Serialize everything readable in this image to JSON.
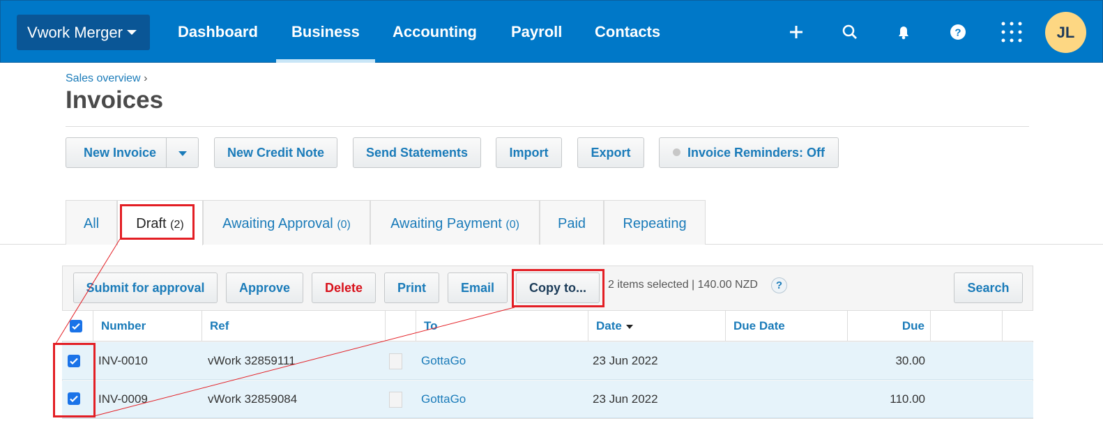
{
  "topnav": {
    "org": "Vwork Merger",
    "items": [
      "Dashboard",
      "Business",
      "Accounting",
      "Payroll",
      "Contacts"
    ],
    "active": "Business",
    "icons": [
      "plus-icon",
      "search-icon",
      "bell-icon",
      "help-icon",
      "apps-grid-icon"
    ],
    "avatar": "JL"
  },
  "page": {
    "breadcrumb": "Sales overview",
    "breadcrumb_sep": "›",
    "title": "Invoices"
  },
  "toolbar": {
    "new_invoice": "New Invoice",
    "new_credit_note": "New Credit Note",
    "send_statements": "Send Statements",
    "import": "Import",
    "export": "Export",
    "reminders": "Invoice Reminders: Off"
  },
  "tabs": [
    {
      "label": "All",
      "count": ""
    },
    {
      "label": "Draft",
      "count": "(2)"
    },
    {
      "label": "Awaiting Approval",
      "count": "(0)"
    },
    {
      "label": "Awaiting Payment",
      "count": "(0)"
    },
    {
      "label": "Paid",
      "count": ""
    },
    {
      "label": "Repeating",
      "count": ""
    }
  ],
  "actions": {
    "submit": "Submit for approval",
    "approve": "Approve",
    "delete": "Delete",
    "print": "Print",
    "email": "Email",
    "copy": "Copy to...",
    "selection": "2 items selected | 140.00 NZD",
    "help": "?",
    "search": "Search"
  },
  "table": {
    "columns": [
      "Number",
      "Ref",
      "To",
      "Date",
      "Due Date",
      "Due"
    ],
    "rows": [
      {
        "number": "INV-0010",
        "ref": "vWork 32859111",
        "to": "GottaGo",
        "date": "23 Jun 2022",
        "due_date": "",
        "due": "30.00",
        "checked": true
      },
      {
        "number": "INV-0009",
        "ref": "vWork 32859084",
        "to": "GottaGo",
        "date": "23 Jun 2022",
        "due_date": "",
        "due": "110.00",
        "checked": true
      }
    ]
  },
  "colors": {
    "nav": "#0078c8",
    "link": "#1a7bb9",
    "highlight": "#e31e24",
    "row": "#e6f3fa"
  }
}
